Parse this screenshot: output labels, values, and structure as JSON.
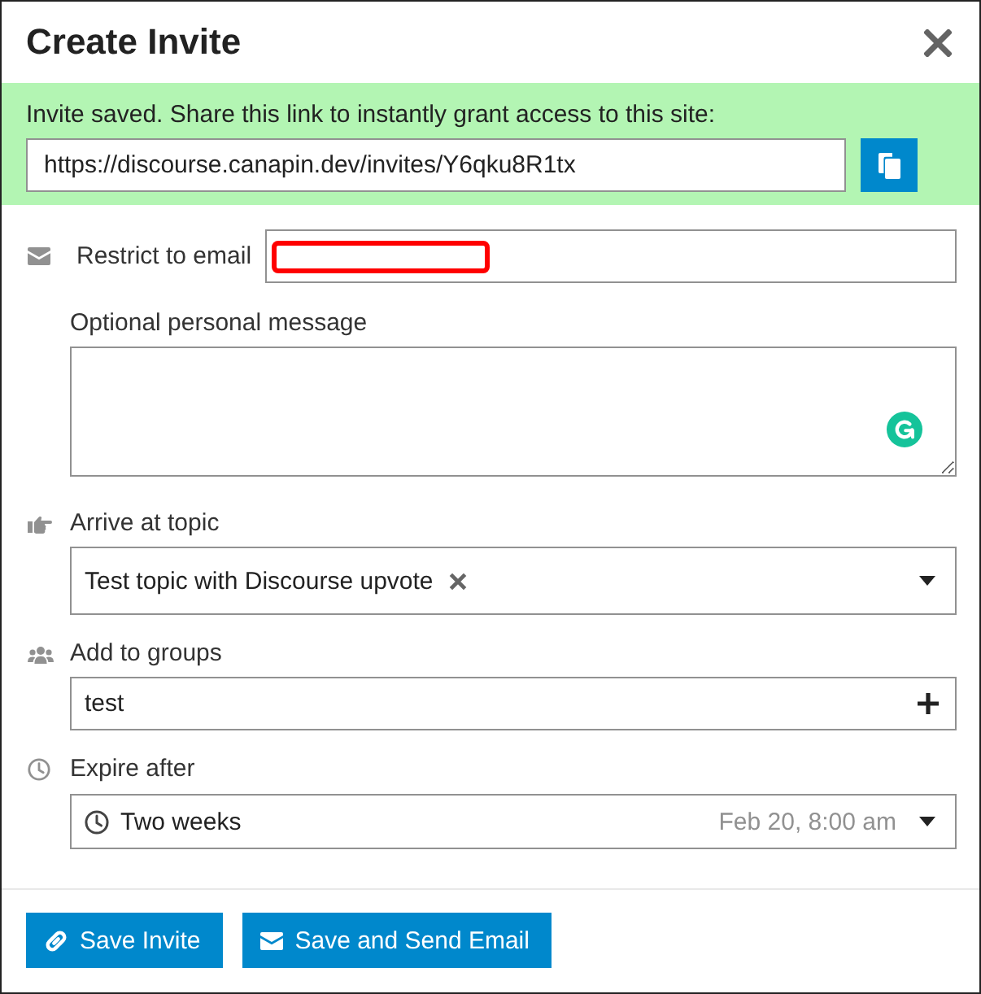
{
  "dialog": {
    "title": "Create Invite"
  },
  "banner": {
    "message": "Invite saved. Share this link to instantly grant access to this site:",
    "link": "https://discourse.canapin.dev/invites/Y6qku8R1tx"
  },
  "fields": [
    {
      "kind": "email",
      "label": "Restrict to email",
      "highlighted": true
    },
    {
      "kind": "message",
      "label": "Optional personal message"
    },
    {
      "kind": "topic",
      "label": "Arrive at topic",
      "value": "Test topic with Discourse upvote"
    },
    {
      "kind": "groups",
      "label": "Add to groups",
      "value": "test"
    },
    {
      "kind": "expiry",
      "label": "Expire after",
      "value": "Two weeks",
      "date": "Feb 20, 8:00 am"
    }
  ],
  "buttons": [
    {
      "kind": "link",
      "label": "Save Invite"
    },
    {
      "kind": "email",
      "label": "Save and Send Email"
    }
  ]
}
